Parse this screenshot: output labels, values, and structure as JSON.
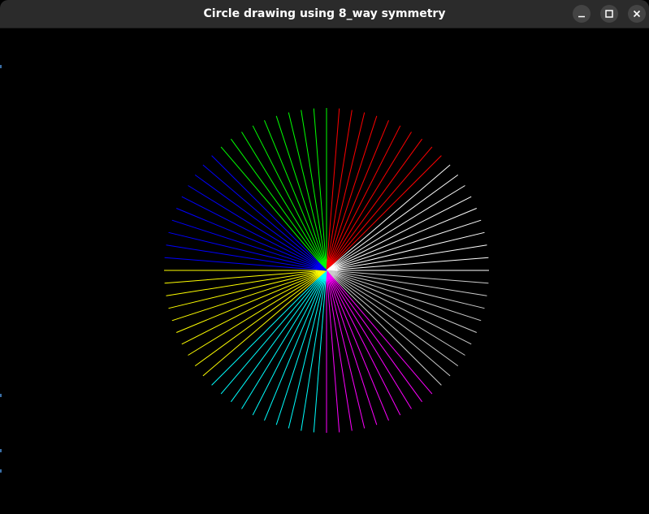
{
  "window": {
    "title": "Circle drawing using 8_way symmetry"
  },
  "controls": {
    "minimize_icon": "minimize-icon",
    "maximize_icon": "maximize-icon",
    "close_icon": "close-icon"
  },
  "drawing": {
    "shape": "circle",
    "symmetry": "8-way",
    "lines_per_octant": 10,
    "radius_px": 200,
    "octant_colors": [
      {
        "octant": "90-135",
        "color": "#00ff00"
      },
      {
        "octant": "45-90",
        "color": "#ff0000"
      },
      {
        "octant": "0-45",
        "color": "#ffffff"
      },
      {
        "octant": "315-360",
        "color": "#cccccc"
      },
      {
        "octant": "270-315",
        "color": "#ff00ff"
      },
      {
        "octant": "225-270",
        "color": "#00ffff"
      },
      {
        "octant": "180-225",
        "color": "#ffff00"
      },
      {
        "octant": "135-180",
        "color": "#0000ff"
      }
    ]
  }
}
